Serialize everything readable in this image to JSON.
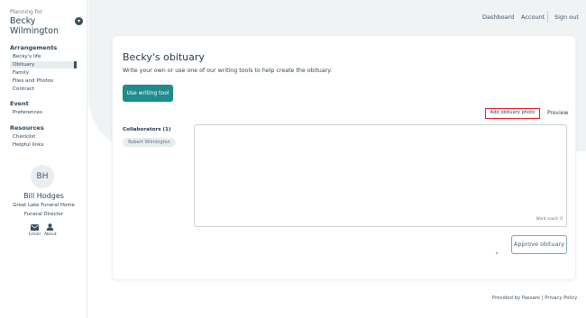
{
  "sidebar": {
    "planning_label": "Planning for",
    "planning_name": "Becky Wilmington",
    "sections": [
      {
        "title": "Arrangements",
        "items": [
          "Becky's life",
          "Obituary",
          "Family",
          "Files and Photos",
          "Contract"
        ]
      },
      {
        "title": "Event",
        "items": [
          "Preferences"
        ]
      },
      {
        "title": "Resources",
        "items": [
          "Checklist",
          "Helpful links"
        ]
      }
    ],
    "director": {
      "initials": "BH",
      "name": "Bill Hodges",
      "home": "Great Lake Funeral Home",
      "role": "Funeral Director",
      "email_label": "Email",
      "about_label": "About"
    }
  },
  "topnav": {
    "dashboard": "Dashboard",
    "account": "Account",
    "signout": "Sign out"
  },
  "main": {
    "title": "Becky's obituary",
    "description": "Write your own or use one of our writing tools to help create the obituary.",
    "writing_tool_label": "Use writing tool",
    "add_photo_label": "Add obituary photo",
    "preview_label": "Preview",
    "collaborators_title": "Collaborators (1)",
    "collaborator": "Robert Wilmington",
    "word_count": "Word count: 0",
    "approve_label": "Approve obituary"
  },
  "footer": {
    "text": "Provided by Passare | Privacy Policy"
  },
  "colors": {
    "accent": "#1e8c8c",
    "highlight": "#e3151d",
    "text": "#2f4655",
    "background": "#f0f3f4"
  }
}
